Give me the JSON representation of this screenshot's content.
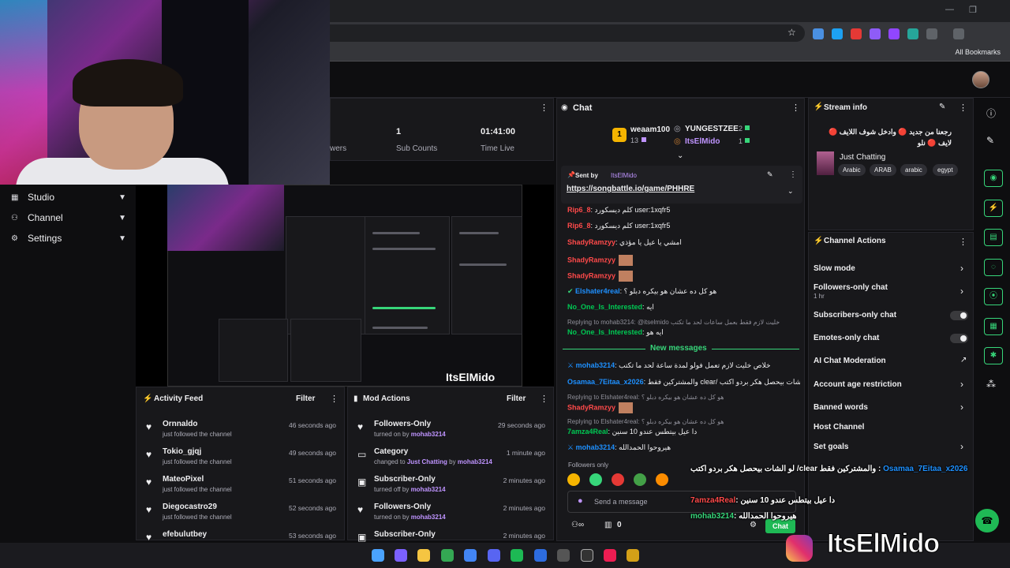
{
  "browser": {
    "window_controls": [
      "—",
      "❐",
      "✕"
    ],
    "bookmarks_label": "All Bookmarks"
  },
  "nav": {
    "items": [
      {
        "icon": "▦",
        "label": "Studio"
      },
      {
        "icon": "⚇",
        "label": "Channel"
      },
      {
        "icon": "⚙",
        "label": "Settings"
      }
    ]
  },
  "stats": {
    "followers_label": "wers",
    "sub_counts_value": "1",
    "sub_counts_label": "Sub Counts",
    "time_live_value": "01:41:00",
    "time_live_label": "Time Live"
  },
  "preview": {
    "brand": "ItsElMido"
  },
  "activity_feed": {
    "title": "Activity Feed",
    "filter": "Filter",
    "items": [
      {
        "name": "Ornnaldo",
        "sub": "just followed the channel",
        "time": "46 seconds ago"
      },
      {
        "name": "Tokio_gjqj",
        "sub": "just followed the channel",
        "time": "49 seconds ago"
      },
      {
        "name": "MateoPixel",
        "sub": "just followed the channel",
        "time": "51 seconds ago"
      },
      {
        "name": "Diegocastro29",
        "sub": "just followed the channel",
        "time": "52 seconds ago"
      },
      {
        "name": "efebulutbey",
        "sub": "",
        "time": "53 seconds ago"
      }
    ]
  },
  "mod_actions": {
    "title": "Mod Actions",
    "filter": "Filter",
    "items": [
      {
        "name": "Followers-Only",
        "sub_prefix": "turned on by ",
        "sub_user": "mohab3214",
        "time": "29 seconds ago"
      },
      {
        "name": "Category",
        "sub_prefix": "changed to ",
        "sub_game": "Just Chatting",
        "sub_mid": " by ",
        "sub_user": "mohab3214",
        "time": "1 minute ago"
      },
      {
        "name": "Subscriber-Only",
        "sub_prefix": "turned off by ",
        "sub_user": "mohab3214",
        "time": "2 minutes ago"
      },
      {
        "name": "Followers-Only",
        "sub_prefix": "turned on by ",
        "sub_user": "mohab3214",
        "time": "2 minutes ago"
      },
      {
        "name": "Subscriber-Only",
        "sub_prefix": "",
        "sub_user": "",
        "time": "2 minutes ago"
      }
    ]
  },
  "chat": {
    "title": "Chat",
    "leaderboard": {
      "first_name": "weaam100",
      "first_count": "13",
      "second_name": "YUNGESTZEE",
      "second_count": "2",
      "third_name": "ItsElMido",
      "third_count": "1",
      "rank": "1"
    },
    "pinned": {
      "sent_by_label": "Sent by",
      "sent_by_user": "ItsElMido",
      "link": "https://songbattle.io/game/PHHRE"
    },
    "messages": [
      {
        "user": "Rip6_8",
        "color": "#ff4a4a",
        "text": ": كلم ديسكورد user:1xqfr5"
      },
      {
        "user": "Rip6_8",
        "color": "#ff4a4a",
        "text": ": كلم ديسكورد user:1xqfr5"
      },
      {
        "user": "ShadyRamzyy",
        "color": "#ff4a4a",
        "text": ": امشي يا عيل يا مؤذي"
      },
      {
        "user": "ShadyRamzyy",
        "color": "#ff4a4a",
        "text": ""
      },
      {
        "user": "ShadyRamzyy",
        "color": "#ff4a4a",
        "text": ""
      },
      {
        "user": "Elshater4real",
        "color": "#1e90ff",
        "text": ": هو كل ده عشان هو بيكره دبلو ؟"
      },
      {
        "user": "No_One_Is_Interested",
        "color": "#00c853",
        "text": ": ايه"
      },
      {
        "user": "No_One_Is_Interested",
        "color": "#00c853",
        "text": ": ايه هو"
      },
      {
        "user": "mohab3214",
        "color": "#1e90ff",
        "text": ": خلاص خليت لازم تعمل فولو لمدة ساعة لحد ما تكتب"
      },
      {
        "user": "Osamaa_7Eitaa_x2026",
        "color": "#1e90ff",
        "text": ": والمشتركين فقط clear/ لو الشات بيحصل هكر بردو اكتب"
      },
      {
        "user": "ShadyRamzyy",
        "color": "#ff4a4a",
        "text": ""
      },
      {
        "user": "7amza4Real",
        "color": "#00c853",
        "text": ": دا عيل بيتطس عندو 10 سنين"
      },
      {
        "user": "mohab3214",
        "color": "#1e90ff",
        "text": ": هيروحوا الحمدالله"
      }
    ],
    "replies": [
      "Replying to mohab3214: @itselmido خليت لازم فقط بعمل ساعات لحد ما تكتب",
      "Replying to Elshater4real: هو كل ده عشان هو بيكره دبلو ؟",
      "Replying to Elshater4real: هو كل ده عشان هو بيكره دبلو ؟"
    ],
    "new_messages_label": "New messages",
    "followers_only_label": "Followers only",
    "input_placeholder": "Send a message",
    "viewers_count": "0",
    "send_label": "Chat"
  },
  "stream_info": {
    "title": "Stream info",
    "stream_title": "رجعنا من جديد 🔴 وادخل شوف اللايف 🔴 لايف 🔴 نلو",
    "category": "Just Chatting",
    "tags": [
      "Arabic",
      "ARAB",
      "arabic",
      "egypt"
    ]
  },
  "channel_actions": {
    "title": "Channel Actions",
    "items": [
      {
        "label": "Slow mode",
        "control": "chevron"
      },
      {
        "label": "Followers-only chat",
        "sub": "1 hr",
        "control": "chevron"
      },
      {
        "label": "Subscribers-only chat",
        "control": "toggle"
      },
      {
        "label": "Emotes-only chat",
        "control": "toggle"
      },
      {
        "label": "AI Chat Moderation",
        "control": "external"
      },
      {
        "label": "Account age restriction",
        "control": "chevron"
      },
      {
        "label": "Banned words",
        "control": "chevron"
      },
      {
        "label": "Host Channel",
        "control": "none"
      },
      {
        "label": "Set goals",
        "control": "chevron"
      }
    ]
  },
  "overlay": {
    "brand": "ItsElMido",
    "chat": [
      {
        "user": "Osamaa_7Eitaa_x2026",
        "text": ": والمشتركين فقط clear/ لو الشات بيحصل هكر بردو اكتب"
      },
      {
        "user": "7amza4Real",
        "text": ": دا عيل بيتطس عندو 10 سنين"
      },
      {
        "user": "mohab3214",
        "text": ": هيروحوا الحمدالله"
      }
    ]
  },
  "colors": {
    "accent_green": "#37d67a",
    "accent_purple": "#bf94ff",
    "panel_bg": "#18181b"
  }
}
